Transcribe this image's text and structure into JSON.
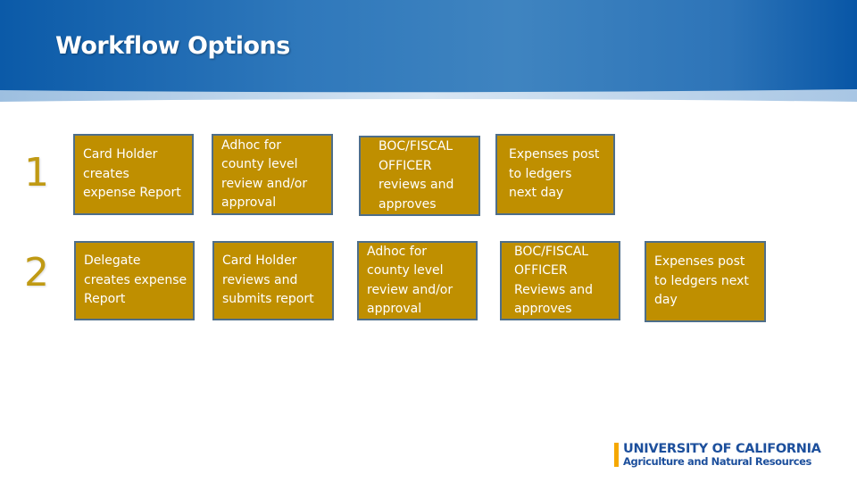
{
  "slide": {
    "title": "Workflow Options",
    "colors": {
      "header_blue_dark": "#0b5aa8",
      "header_blue_light": "#3f84c0",
      "header_band": "#9dc0e2",
      "box_fill": "#bf8f00",
      "box_border": "#4e6e8a",
      "number_color": "#c09a14",
      "logo_text": "#1c4f9c",
      "logo_bar": "#f5a800"
    }
  },
  "workflows": [
    {
      "number": "1",
      "steps": [
        "Card Holder\ncreates\nexpense Report",
        "Adhoc for\ncounty level\nreview and/or\napproval",
        "BOC/FISCAL\nOFFICER\nreviews and\napproves",
        "Expenses post\nto ledgers\nnext day"
      ]
    },
    {
      "number": "2",
      "steps": [
        "Delegate\ncreates expense\nReport",
        "Card Holder\nreviews and\nsubmits report",
        "Adhoc for\ncounty level\nreview and/or\napproval",
        "BOC/FISCAL\nOFFICER\nReviews and\napproves",
        "Expenses post\nto ledgers next\nday"
      ]
    }
  ],
  "logo": {
    "line1": "UNIVERSITY OF CALIFORNIA",
    "line2": "Agriculture and Natural Resources"
  }
}
